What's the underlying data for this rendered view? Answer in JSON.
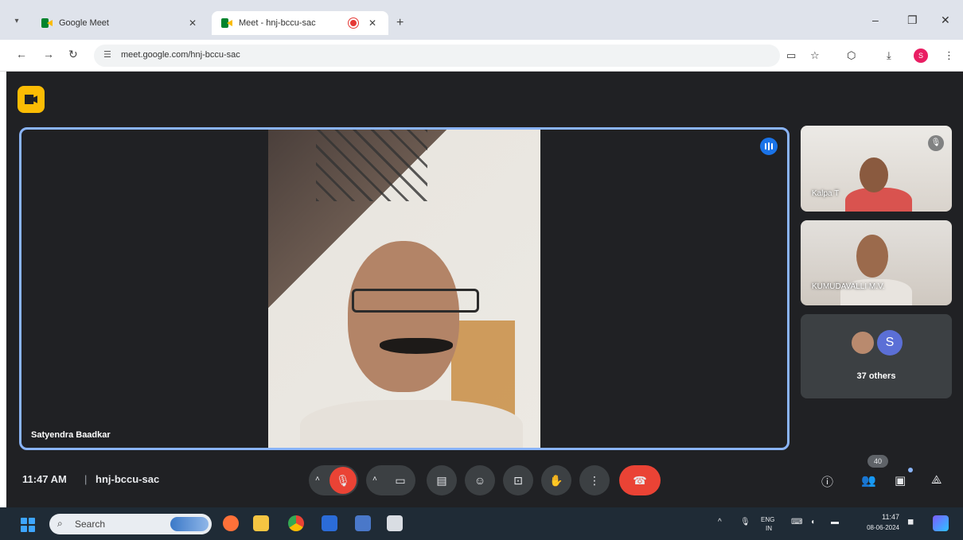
{
  "browser": {
    "tabs": [
      {
        "title": "Google Meet",
        "active": false
      },
      {
        "title": "Meet - hnj-bccu-sac",
        "active": true
      }
    ],
    "url": "meet.google.com/hnj-bccu-sac",
    "profile_initial": "S"
  },
  "meet": {
    "main_speaker": "Satyendra Baadkar",
    "participants": [
      {
        "name": "Kalpa T"
      },
      {
        "name": "KUMUDAVALLI M.V."
      }
    ],
    "others_avatar_initial": "S",
    "others_label": "37 others",
    "time": "11:47 AM",
    "meeting_code": "hnj-bccu-sac",
    "people_count": "40"
  },
  "taskbar": {
    "search_placeholder": "Search",
    "language": "ENG",
    "region": "IN",
    "clock_time": "11:47",
    "clock_date": "08-06-2024"
  },
  "colors": {
    "meet_bg": "#202124",
    "accent_blue": "#8ab4f8",
    "hangup_red": "#ea4335",
    "logo_yellow": "#fbbc04"
  }
}
